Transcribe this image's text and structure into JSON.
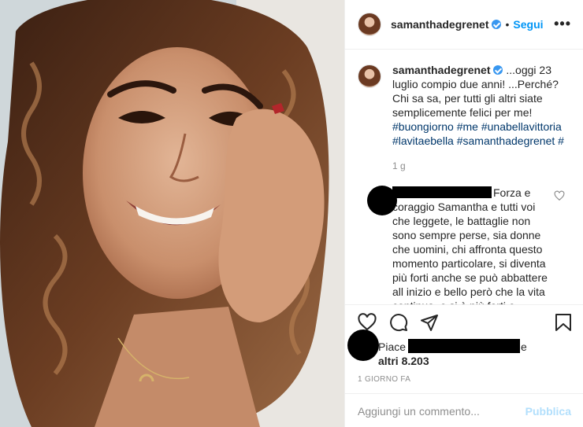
{
  "post": {
    "username": "samanthadegrenet",
    "follow_label": "Segui",
    "more_label": "•••",
    "separator": "•"
  },
  "caption": {
    "username": "samanthadegrenet",
    "text": "...oggi 23 luglio compio due anni! ...Perché? Chi sa sa, per tutti gli altri siate semplicemente felici per me!",
    "hashtags": "#buongiorno #me #unabellavittoria #lavitaebella #samanthadegrenet #",
    "time": "1 g"
  },
  "comment": {
    "text": "Forza e coraggio Samantha e tutti voi che leggete, le battaglie non sono sempre perse, sia donne che uomini, chi affronta questo momento particolare, si diventa più forti anche se può abbattere all inizio e bello però che la vita continua, e si è più forti e coraggiosi di"
  },
  "likes": {
    "prefix": "Piace a",
    "suffix": "e",
    "count": "altri 8.203"
  },
  "date": "1 GIORNO FA",
  "add_comment": {
    "placeholder": "Aggiungi un commento...",
    "publish": "Pubblica"
  }
}
